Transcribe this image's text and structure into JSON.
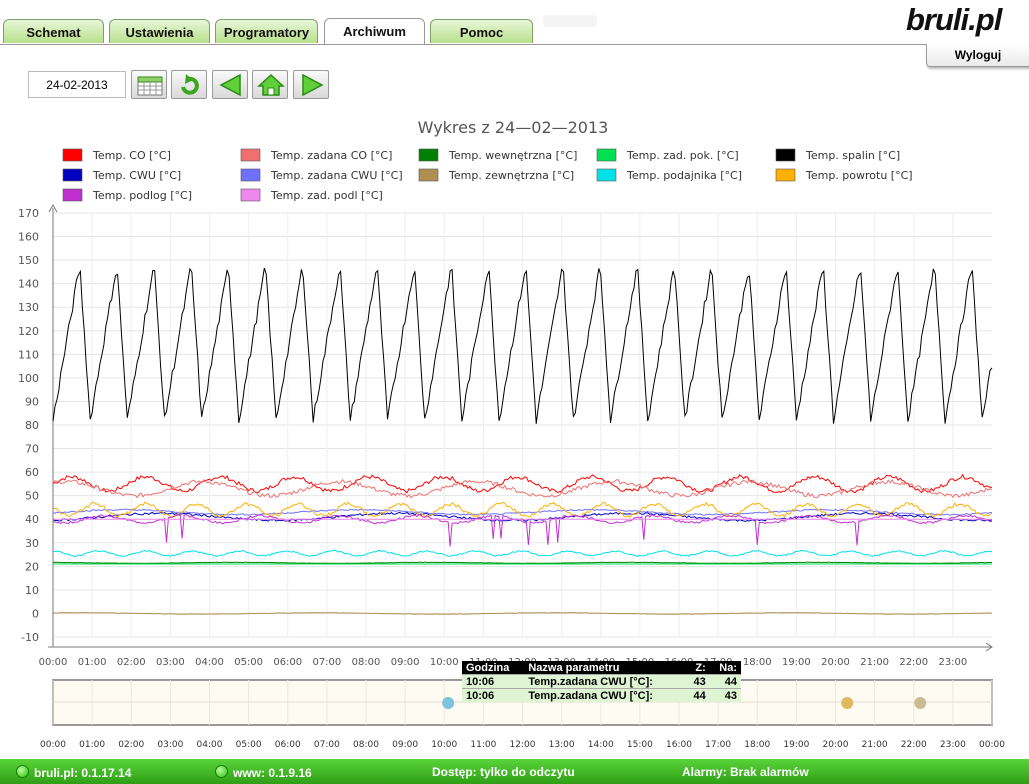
{
  "tabs": [
    {
      "label": "Schemat"
    },
    {
      "label": "Ustawienia"
    },
    {
      "label": "Programatory"
    },
    {
      "label": "Archiwum"
    },
    {
      "label": "Pomoc"
    }
  ],
  "active_tab": "Archiwum",
  "logo": "bruli.pl",
  "logout_label": "Wyloguj",
  "toolbar": {
    "date": "24-02-2013",
    "icons": [
      "calendar-icon",
      "refresh-icon",
      "prev-arrow-icon",
      "home-icon",
      "next-arrow-icon"
    ]
  },
  "chart_data": {
    "type": "line",
    "title": "Wykres z 24—02—2013",
    "x_ticks": [
      "00:00",
      "01:00",
      "02:00",
      "03:00",
      "04:00",
      "05:00",
      "06:00",
      "07:00",
      "08:00",
      "09:00",
      "10:00",
      "11:00",
      "12:00",
      "13:00",
      "14:00",
      "15:00",
      "16:00",
      "17:00",
      "18:00",
      "19:00",
      "20:00",
      "21:00",
      "22:00",
      "23:00"
    ],
    "nav_ticks": [
      "00:00",
      "01:00",
      "02:00",
      "03:00",
      "04:00",
      "05:00",
      "06:00",
      "07:00",
      "08:00",
      "09:00",
      "10:00",
      "11:00",
      "12:00",
      "13:00",
      "14:00",
      "15:00",
      "16:00",
      "17:00",
      "18:00",
      "19:00",
      "20:00",
      "21:00",
      "22:00",
      "23:00",
      "00:00"
    ],
    "y_ticks": [
      170,
      160,
      150,
      140,
      130,
      120,
      110,
      100,
      90,
      80,
      70,
      60,
      50,
      40,
      30,
      20,
      10,
      0,
      -10
    ],
    "ylim": [
      -10,
      170
    ],
    "xlim": [
      0,
      24
    ],
    "grid": true,
    "legend_position": "top",
    "series": [
      {
        "name": "Temp. CO [°C]",
        "color": "#ff0000",
        "level": 55,
        "swing": 3,
        "period": 1.9
      },
      {
        "name": "Temp. zadana CO [°C]",
        "color": "#f07070",
        "level": 53,
        "swing": 3,
        "period": 3.5
      },
      {
        "name": "Temp. wewnętrzna [°C]",
        "color": "#008000",
        "level": 21.5,
        "swing": 0.2,
        "period": 5
      },
      {
        "name": "Temp. zad. pok. [°C]",
        "color": "#00e050",
        "level": 21,
        "swing": 0,
        "period": 5
      },
      {
        "name": "Temp. spalin [°C]",
        "color": "#000000",
        "level": 115,
        "swing": 33,
        "period": 0.95
      },
      {
        "name": "Temp. CWU [°C]",
        "color": "#0000c0",
        "level": 41,
        "swing": 1.5,
        "period": 6
      },
      {
        "name": "Temp. zadana CWU [°C]",
        "color": "#7070ff",
        "level": 43,
        "swing": 1,
        "period": 6
      },
      {
        "name": "Temp. zewnętrzna [°C]",
        "color": "#b09050",
        "level": 0,
        "swing": 0.3,
        "period": 6
      },
      {
        "name": "Temp. podajnika [°C]",
        "color": "#00e0e8",
        "level": 25.5,
        "swing": 1,
        "period": 1.2
      },
      {
        "name": "Temp. powrotu [°C]",
        "color": "#ffb000",
        "level": 44,
        "swing": 2.5,
        "period": 1.3
      },
      {
        "name": "Temp. podlog [°C]",
        "color": "#c030d0",
        "level": 40,
        "swing": 1.5,
        "period": 2
      },
      {
        "name": "Temp. zad. podl [°C]",
        "color": "#ee88ee",
        "level": 40,
        "swing": 0,
        "period": 5
      }
    ],
    "event_markers": [
      {
        "time": "10:06",
        "color": "#7cc4dc"
      },
      {
        "time": "20:18",
        "color": "#e0b860"
      },
      {
        "time": "22:10",
        "color": "#cbbb90"
      }
    ]
  },
  "tooltip": {
    "headers": [
      "Godzina",
      "Nazwa parametru",
      "Z:",
      "Na:"
    ],
    "rows": [
      {
        "time": "10:06",
        "param": "Temp.zadana CWU [°C]:",
        "from": "43",
        "to": "44"
      },
      {
        "time": "10:06",
        "param": "Temp.zadana CWU [°C]:",
        "from": "44",
        "to": "43"
      }
    ]
  },
  "status": {
    "version": "bruli.pl: 0.1.17.14",
    "www": "www: 0.1.9.16",
    "access": "Dostęp: tylko do odczytu",
    "alarms": "Alarmy: Brak alarmów"
  }
}
